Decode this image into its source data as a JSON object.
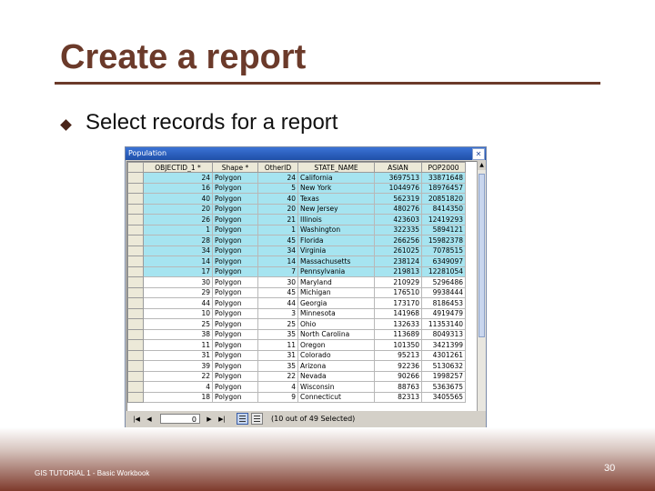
{
  "slide": {
    "title": "Create a report",
    "bullet": "Select records for a report",
    "footer": "GIS TUTORIAL 1 - Basic Workbook",
    "page_number": "30"
  },
  "window": {
    "title": "Population",
    "close_glyph": "✕"
  },
  "table": {
    "columns": [
      "OBJECTID_1 *",
      "Shape *",
      "OtherID",
      "STATE_NAME",
      "ASIAN",
      "POP2000"
    ],
    "rows": [
      {
        "selected": true,
        "cells": [
          "24",
          "Polygon",
          "24",
          "California",
          "3697513",
          "33871648"
        ]
      },
      {
        "selected": true,
        "cells": [
          "16",
          "Polygon",
          "5",
          "New York",
          "1044976",
          "18976457"
        ]
      },
      {
        "selected": true,
        "cells": [
          "40",
          "Polygon",
          "40",
          "Texas",
          "562319",
          "20851820"
        ]
      },
      {
        "selected": true,
        "cells": [
          "20",
          "Polygon",
          "20",
          "New Jersey",
          "480276",
          "8414350"
        ]
      },
      {
        "selected": true,
        "cells": [
          "26",
          "Polygon",
          "21",
          "Illinois",
          "423603",
          "12419293"
        ]
      },
      {
        "selected": true,
        "cells": [
          "1",
          "Polygon",
          "1",
          "Washington",
          "322335",
          "5894121"
        ]
      },
      {
        "selected": true,
        "cells": [
          "28",
          "Polygon",
          "45",
          "Florida",
          "266256",
          "15982378"
        ]
      },
      {
        "selected": true,
        "cells": [
          "34",
          "Polygon",
          "34",
          "Virginia",
          "261025",
          "7078515"
        ]
      },
      {
        "selected": true,
        "cells": [
          "14",
          "Polygon",
          "14",
          "Massachusetts",
          "238124",
          "6349097"
        ]
      },
      {
        "selected": true,
        "cells": [
          "17",
          "Polygon",
          "7",
          "Pennsylvania",
          "219813",
          "12281054"
        ]
      },
      {
        "selected": false,
        "cells": [
          "30",
          "Polygon",
          "30",
          "Maryland",
          "210929",
          "5296486"
        ]
      },
      {
        "selected": false,
        "cells": [
          "29",
          "Polygon",
          "45",
          "Michigan",
          "176510",
          "9938444"
        ]
      },
      {
        "selected": false,
        "cells": [
          "44",
          "Polygon",
          "44",
          "Georgia",
          "173170",
          "8186453"
        ]
      },
      {
        "selected": false,
        "cells": [
          "10",
          "Polygon",
          "3",
          "Minnesota",
          "141968",
          "4919479"
        ]
      },
      {
        "selected": false,
        "cells": [
          "25",
          "Polygon",
          "25",
          "Ohio",
          "132633",
          "11353140"
        ]
      },
      {
        "selected": false,
        "cells": [
          "38",
          "Polygon",
          "35",
          "North Carolina",
          "113689",
          "8049313"
        ]
      },
      {
        "selected": false,
        "cells": [
          "11",
          "Polygon",
          "11",
          "Oregon",
          "101350",
          "3421399"
        ]
      },
      {
        "selected": false,
        "cells": [
          "31",
          "Polygon",
          "31",
          "Colorado",
          "95213",
          "4301261"
        ]
      },
      {
        "selected": false,
        "cells": [
          "39",
          "Polygon",
          "35",
          "Arizona",
          "92236",
          "5130632"
        ]
      },
      {
        "selected": false,
        "cells": [
          "22",
          "Polygon",
          "22",
          "Nevada",
          "90266",
          "1998257"
        ]
      },
      {
        "selected": false,
        "cells": [
          "4",
          "Polygon",
          "4",
          "Wisconsin",
          "88763",
          "5363675"
        ]
      },
      {
        "selected": false,
        "cells": [
          "18",
          "Polygon",
          "9",
          "Connecticut",
          "82313",
          "3405565"
        ]
      }
    ]
  },
  "nav": {
    "first_glyph": "|◀",
    "prev_glyph": "◀",
    "record_value": "0",
    "next_glyph": "▶",
    "last_glyph": "▶|",
    "status": "(10 out of 49 Selected)"
  },
  "colors": {
    "title_brown": "#6b3a2a",
    "selected_row": "#a6e4f0",
    "titlebar_blue": "#1f4fa8"
  },
  "icons": {
    "bullet": "diamond-bullet-icon",
    "close": "close-icon",
    "show-all-records": "show-all-records-icon",
    "show-selected-records": "show-selected-records-icon"
  }
}
